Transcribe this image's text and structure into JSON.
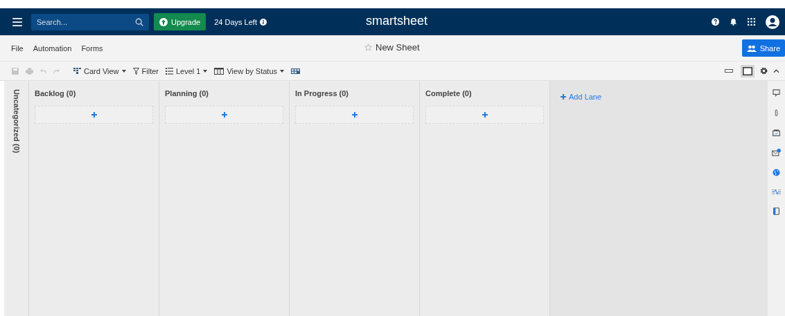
{
  "header": {
    "search": {
      "placeholder": "Search..."
    },
    "upgrade": "Upgrade",
    "trial": "24 Days Left",
    "logo": "smartsheet"
  },
  "menu": [
    "File",
    "Automation",
    "Forms"
  ],
  "sheet_title": "New Sheet",
  "share": "Share",
  "toolbar": {
    "view": "Card View",
    "filter": "Filter",
    "level": "Level 1",
    "group": "View by Status"
  },
  "card_sizes": [
    {
      "kind": "compact",
      "selected": false
    },
    {
      "kind": "full",
      "selected": true
    }
  ],
  "uncategorized": "Uncategorized (0)",
  "lanes": [
    {
      "title": "Backlog (0)"
    },
    {
      "title": "Planning (0)"
    },
    {
      "title": "In Progress (0)"
    },
    {
      "title": "Complete (0)"
    }
  ],
  "add_lane": "Add Lane",
  "side_panel": [
    {
      "kind": "comment"
    },
    {
      "kind": "attachment"
    },
    {
      "kind": "proof"
    },
    {
      "kind": "request"
    },
    {
      "kind": "publish"
    },
    {
      "kind": "activity"
    },
    {
      "kind": "summary"
    }
  ]
}
